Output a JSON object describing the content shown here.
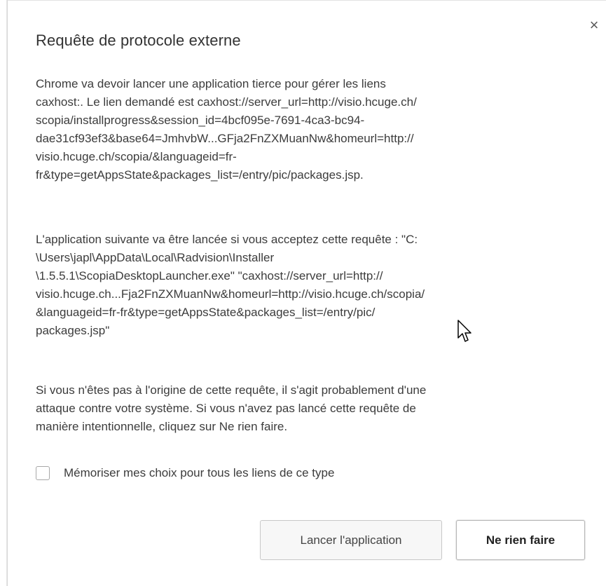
{
  "dialog": {
    "title": "Requête de protocole externe",
    "close_symbol": "×",
    "paragraph1": "Chrome va devoir lancer une application tierce pour gérer les liens\ncaxhost:. Le lien demandé est caxhost://server_url=http://visio.hcuge.ch/\nscopia/installprogress&session_id=4bcf095e-7691-4ca3-bc94-\ndae31cf93ef3&base64=JmhvbW...GFja2FnZXMuanNw&homeurl=http://\nvisio.hcuge.ch/scopia/&languageid=fr-\nfr&type=getAppsState&packages_list=/entry/pic/packages.jsp.",
    "paragraph2": "L'application suivante va être lancée si vous acceptez cette requête : \"C:\n\\Users\\japl\\AppData\\Local\\Radvision\\Installer\n\\1.5.5.1\\ScopiaDesktopLauncher.exe\" \"caxhost://server_url=http://\nvisio.hcuge.ch...Fja2FnZXMuanNw&homeurl=http://visio.hcuge.ch/scopia/\n&languageid=fr-fr&type=getAppsState&packages_list=/entry/pic/\npackages.jsp\"",
    "paragraph3": "Si vous n'êtes pas à l'origine de cette requête, il s'agit probablement d'une\nattaque contre votre système. Si vous n'avez pas lancé cette requête de\nmanière intentionnelle, cliquez sur Ne rien faire.",
    "remember_label": "Mémoriser mes choix pour tous les liens de ce type",
    "remember_checked": false,
    "launch_button": "Lancer l'application",
    "cancel_button": "Ne rien faire"
  }
}
